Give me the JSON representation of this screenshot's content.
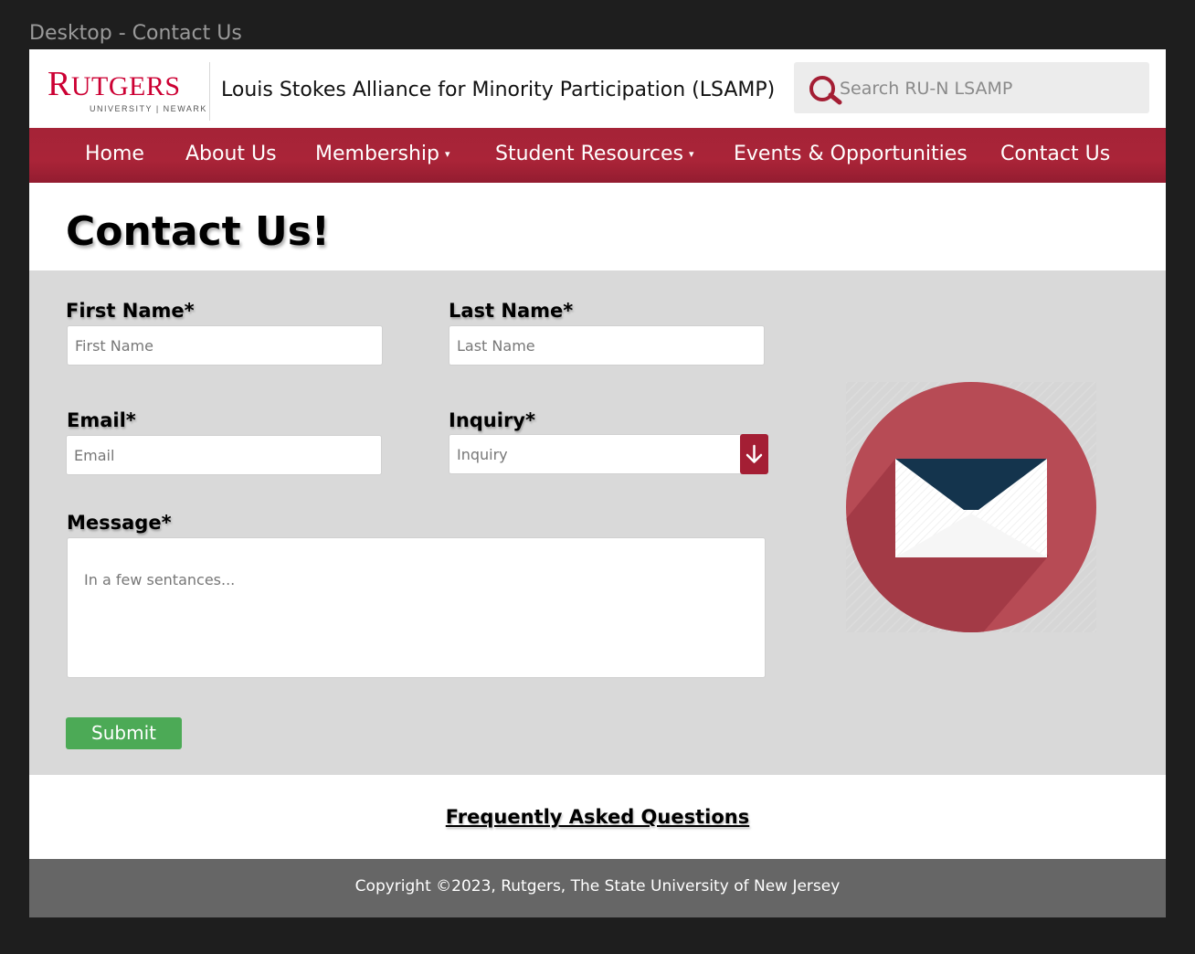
{
  "frame": {
    "label": "Desktop - Contact Us"
  },
  "header": {
    "logo": {
      "word_big": "R",
      "word_rest": "UTGERS",
      "sub": "UNIVERSITY | NEWARK"
    },
    "site_title": "Louis Stokes Alliance for Minority Participation (LSAMP)",
    "search": {
      "placeholder": "Search RU-N LSAMP",
      "icon": "search-icon"
    }
  },
  "nav": {
    "items": [
      {
        "label": "Home",
        "has_dropdown": false
      },
      {
        "label": "About Us",
        "has_dropdown": false
      },
      {
        "label": "Membership",
        "has_dropdown": true
      },
      {
        "label": "Student Resources",
        "has_dropdown": true
      },
      {
        "label": "Events & Opportunities",
        "has_dropdown": false
      },
      {
        "label": "Contact Us",
        "has_dropdown": false
      }
    ],
    "caret": "▾"
  },
  "main": {
    "title": "Contact Us!",
    "form": {
      "first_name": {
        "label": "First Name*",
        "placeholder": "First Name"
      },
      "last_name": {
        "label": "Last Name*",
        "placeholder": "Last Name"
      },
      "email": {
        "label": "Email*",
        "placeholder": "Email"
      },
      "inquiry": {
        "label": "Inquiry*",
        "placeholder": "Inquiry"
      },
      "message": {
        "label": "Message*",
        "placeholder": "In a few sentances..."
      },
      "submit_label": "Submit"
    },
    "illustration": "envelope-icon"
  },
  "faq": {
    "label": "Frequently Asked Questions"
  },
  "footer": {
    "copyright": "Copyright ©2023, Rutgers, The State University of New Jersey"
  },
  "colors": {
    "brand_red": "#a52337",
    "submit_green": "#4caa56",
    "form_bg": "#d9d9d9",
    "footer_bg": "#666666",
    "envelope_flap": "#14344d"
  }
}
